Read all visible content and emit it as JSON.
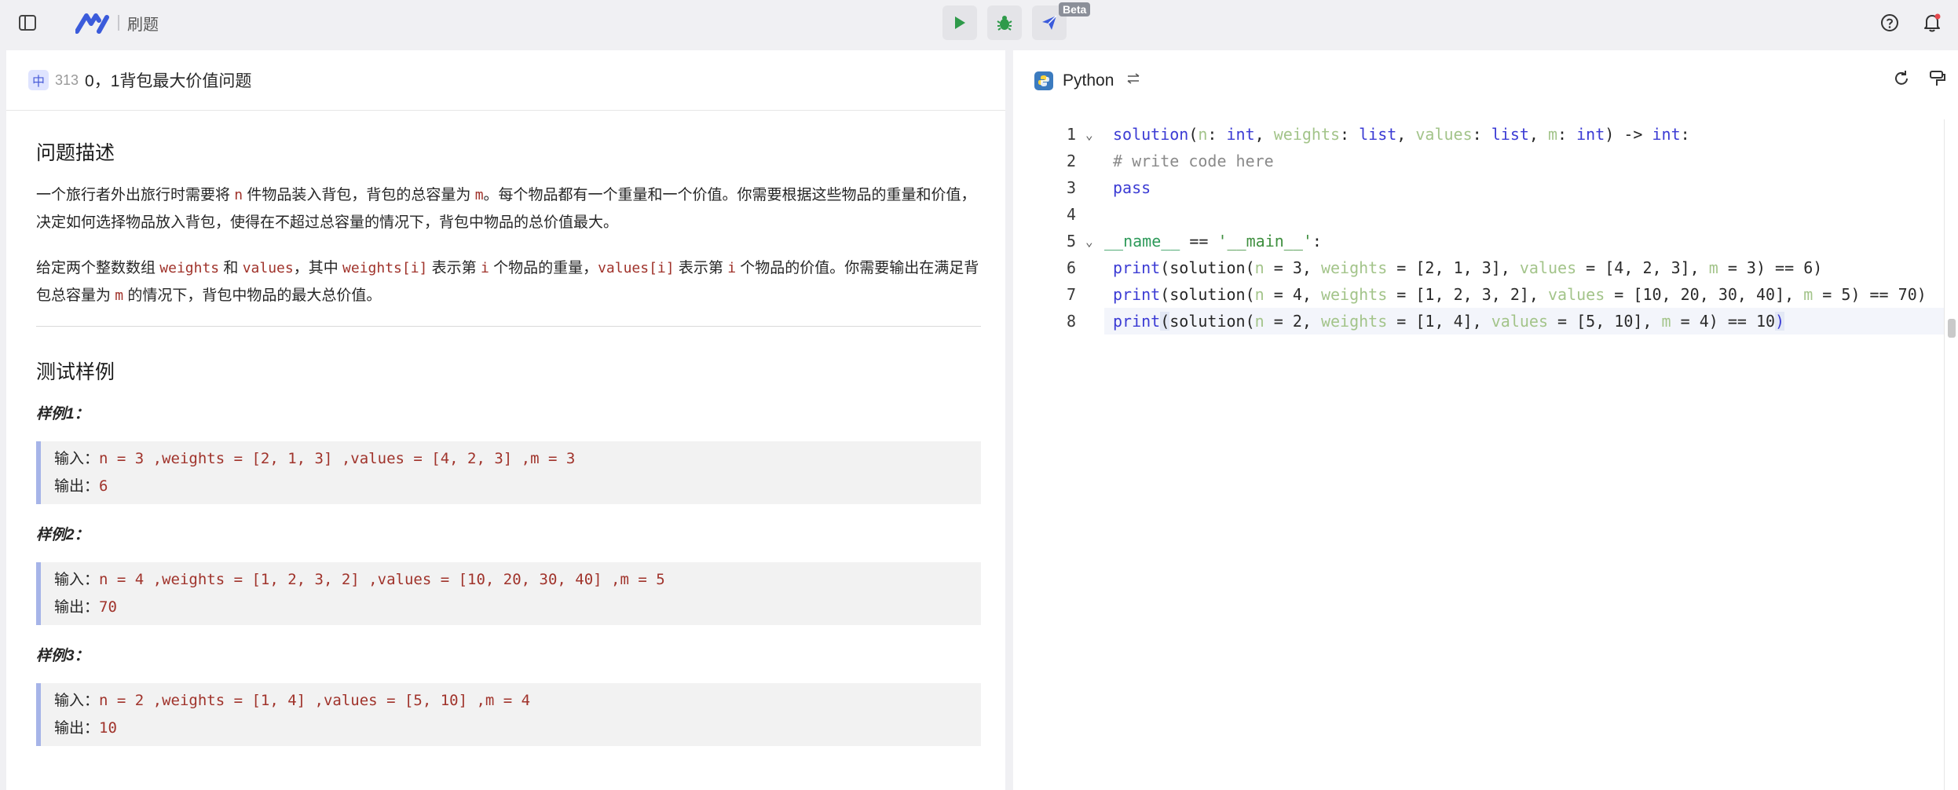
{
  "topbar": {
    "title": "刷题",
    "beta_label": "Beta",
    "icons": [
      "sidebar-toggle-icon",
      "logo",
      "run-icon",
      "debug-icon",
      "submit-icon",
      "help-icon",
      "bell-icon"
    ]
  },
  "question": {
    "difficulty": "中",
    "number": "313",
    "title": "0，1背包最大价值问题",
    "desc_heading": "问题描述",
    "para1": {
      "a": "一个旅行者外出旅行时需要将 ",
      "n": "n",
      "b": " 件物品装入背包，背包的总容量为 ",
      "m": "m",
      "c": "。每个物品都有一个重量和一个价值。你需要根据这些物品的重量和价值，决定如何选择物品放入背包，使得在不超过总容量的情况下，背包中物品的总价值最大。"
    },
    "para2": {
      "a": "给定两个整数数组 ",
      "weights": "weights",
      "b": " 和 ",
      "values": "values",
      "c": "，其中 ",
      "weights_i": "weights[i]",
      "d": " 表示第 ",
      "i1": "i",
      "e": " 个物品的重量，",
      "values_i": "values[i]",
      "f": " 表示第 ",
      "i2": "i",
      "g": " 个物品的价值。你需要输出在满足背包总容量为 ",
      "m": "m",
      "h": " 的情况下，背包中物品的最大总价值。"
    },
    "examples_heading": "测试样例",
    "examples": [
      {
        "label": "样例1：",
        "input_label": "输入：",
        "input": "n = 3 ,weights = [2, 1, 3] ,values = [4, 2, 3] ,m = 3",
        "output_label": "输出：",
        "output": "6"
      },
      {
        "label": "样例2：",
        "input_label": "输入：",
        "input": "n = 4 ,weights = [1, 2, 3, 2] ,values = [10, 20, 30, 40] ,m = 5",
        "output_label": "输出：",
        "output": "70"
      },
      {
        "label": "样例3：",
        "input_label": "输入：",
        "input": "n = 2 ,weights = [1, 4] ,values = [5, 10] ,m = 4",
        "output_label": "输出：",
        "output": "10"
      }
    ]
  },
  "editor": {
    "language": "Python",
    "line_numbers": [
      "1",
      "2",
      "3",
      "4",
      "5",
      "6",
      "7",
      "8"
    ],
    "lines": [
      "solution(n: int, weights: list, values: list, m: int) -> int:",
      "# write code here",
      "pass",
      "",
      "__name__ == '__main__':",
      "print(solution(n = 3, weights = [2, 1, 3], values = [4, 2, 3], m = 3) == 6)",
      "print(solution(n = 4, weights = [1, 2, 3, 2], values = [10, 20, 30, 40], m = 5) == 70)",
      "print(solution(n = 2, weights = [1, 4], values = [5, 10], m = 4) == 10)"
    ],
    "active_line": "8"
  },
  "colors": {
    "accent": "#4a5dd8",
    "run_green": "#2e9a4a",
    "keyword": "#3b3bd4",
    "param": "#a3c48a",
    "code_text": "#a0332b"
  }
}
